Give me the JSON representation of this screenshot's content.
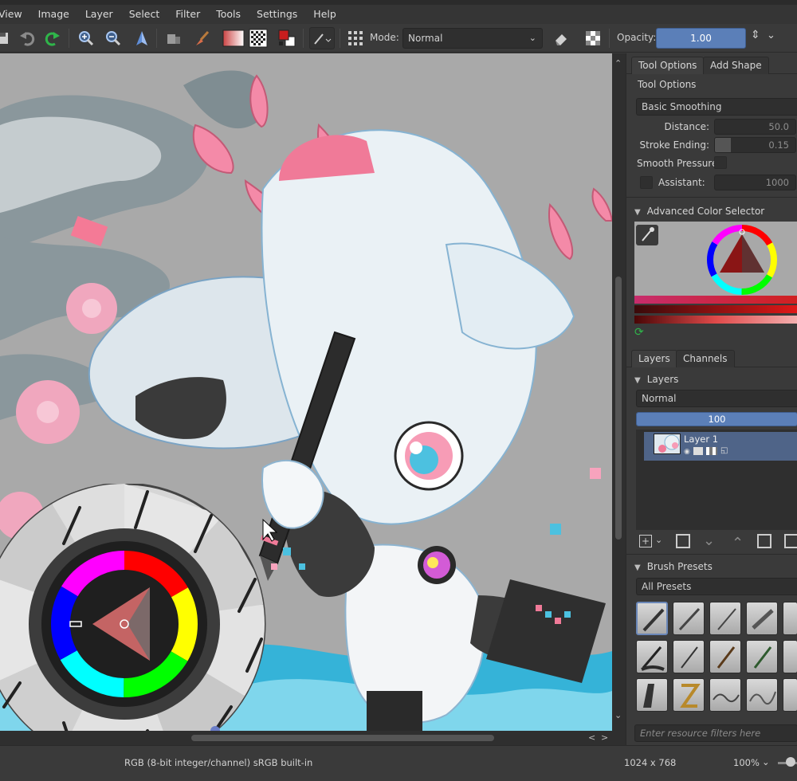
{
  "menu": [
    "View",
    "Image",
    "Layer",
    "Select",
    "Filter",
    "Tools",
    "Settings",
    "Help"
  ],
  "toolbar": {
    "mode_label": "Mode:",
    "mode_value": "Normal",
    "opacity_label": "Opacity:",
    "opacity_value": "1.00"
  },
  "tool_options": {
    "tabs": [
      "Tool Options",
      "Add Shape"
    ],
    "header": "Tool Options",
    "smoothing": "Basic Smoothing",
    "distance_label": "Distance:",
    "distance_value": "50.0",
    "stroke_ending_label": "Stroke Ending:",
    "stroke_ending_value": "0.15",
    "smooth_pressure_label": "Smooth Pressure",
    "assistant_label": "Assistant:",
    "assistant_value": "1000"
  },
  "color_selector": {
    "title": "Advanced Color Selector"
  },
  "layers": {
    "tabs": [
      "Layers",
      "Channels"
    ],
    "title": "Layers",
    "blend_mode": "Normal",
    "opacity": "100",
    "opacity_fraction": 1.0,
    "items": [
      {
        "name": "Layer 1"
      }
    ]
  },
  "brush_presets": {
    "title": "Brush Presets",
    "tag": "All Presets",
    "filter_placeholder": "Enter resource filters here"
  },
  "status": {
    "color_space": "RGB (8-bit integer/channel)  sRGB built-in",
    "dimensions": "1024 x 768",
    "zoom": "100%"
  },
  "colors": {
    "accent": "#5a7ab0",
    "panel": "#3a3a3a",
    "canvas_bg": "#a9a9a9"
  }
}
